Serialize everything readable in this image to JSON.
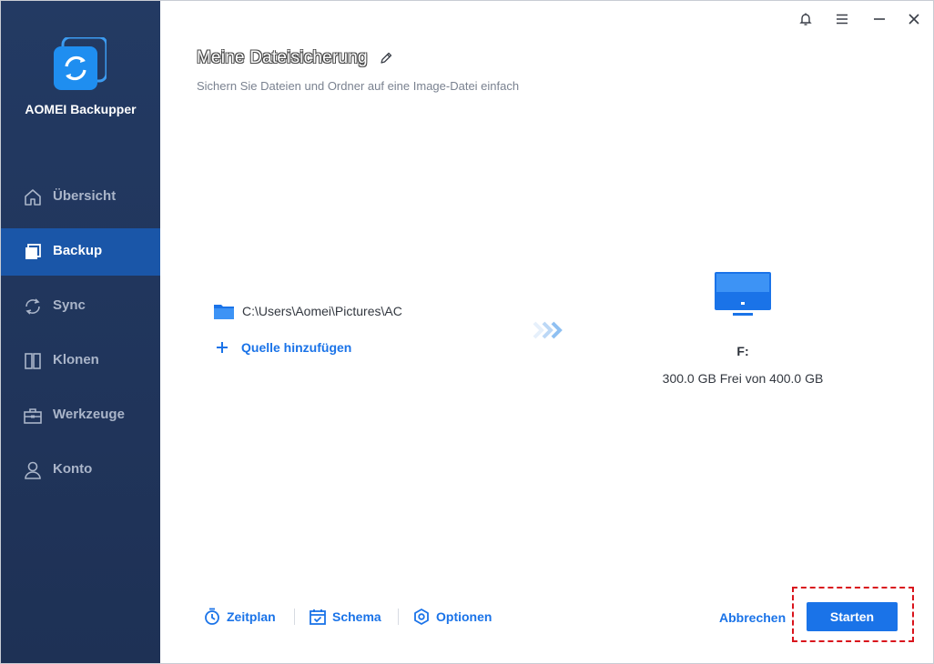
{
  "app": {
    "name": "AOMEI Backupper"
  },
  "sidebar": {
    "items": [
      {
        "label": "Übersicht",
        "icon": "home-icon"
      },
      {
        "label": "Backup",
        "icon": "backup-icon",
        "active": true
      },
      {
        "label": "Sync",
        "icon": "sync-icon"
      },
      {
        "label": "Klonen",
        "icon": "clone-icon"
      },
      {
        "label": "Werkzeuge",
        "icon": "toolbox-icon"
      },
      {
        "label": "Konto",
        "icon": "user-icon"
      }
    ]
  },
  "window_controls": [
    "bell-icon",
    "menu-icon",
    "minimize-icon",
    "close-icon"
  ],
  "header": {
    "title": "Meine Dateisicherung",
    "subtitle": "Sichern Sie Dateien und Ordner auf eine Image-Datei einfach"
  },
  "source": {
    "items": [
      {
        "path": "C:\\Users\\Aomei\\Pictures\\AC"
      }
    ],
    "add_label": "Quelle hinzufügen"
  },
  "destination": {
    "drive": "F:",
    "space": "300.0 GB Frei von 400.0 GB"
  },
  "footer": {
    "schedule_label": "Zeitplan",
    "scheme_label": "Schema",
    "options_label": "Optionen",
    "cancel_label": "Abbrechen",
    "start_label": "Starten"
  },
  "colors": {
    "sidebar_bg": "#233a63",
    "active_item": "#1a56a8",
    "accent": "#1a73e8",
    "highlight_border": "#d9141c"
  }
}
